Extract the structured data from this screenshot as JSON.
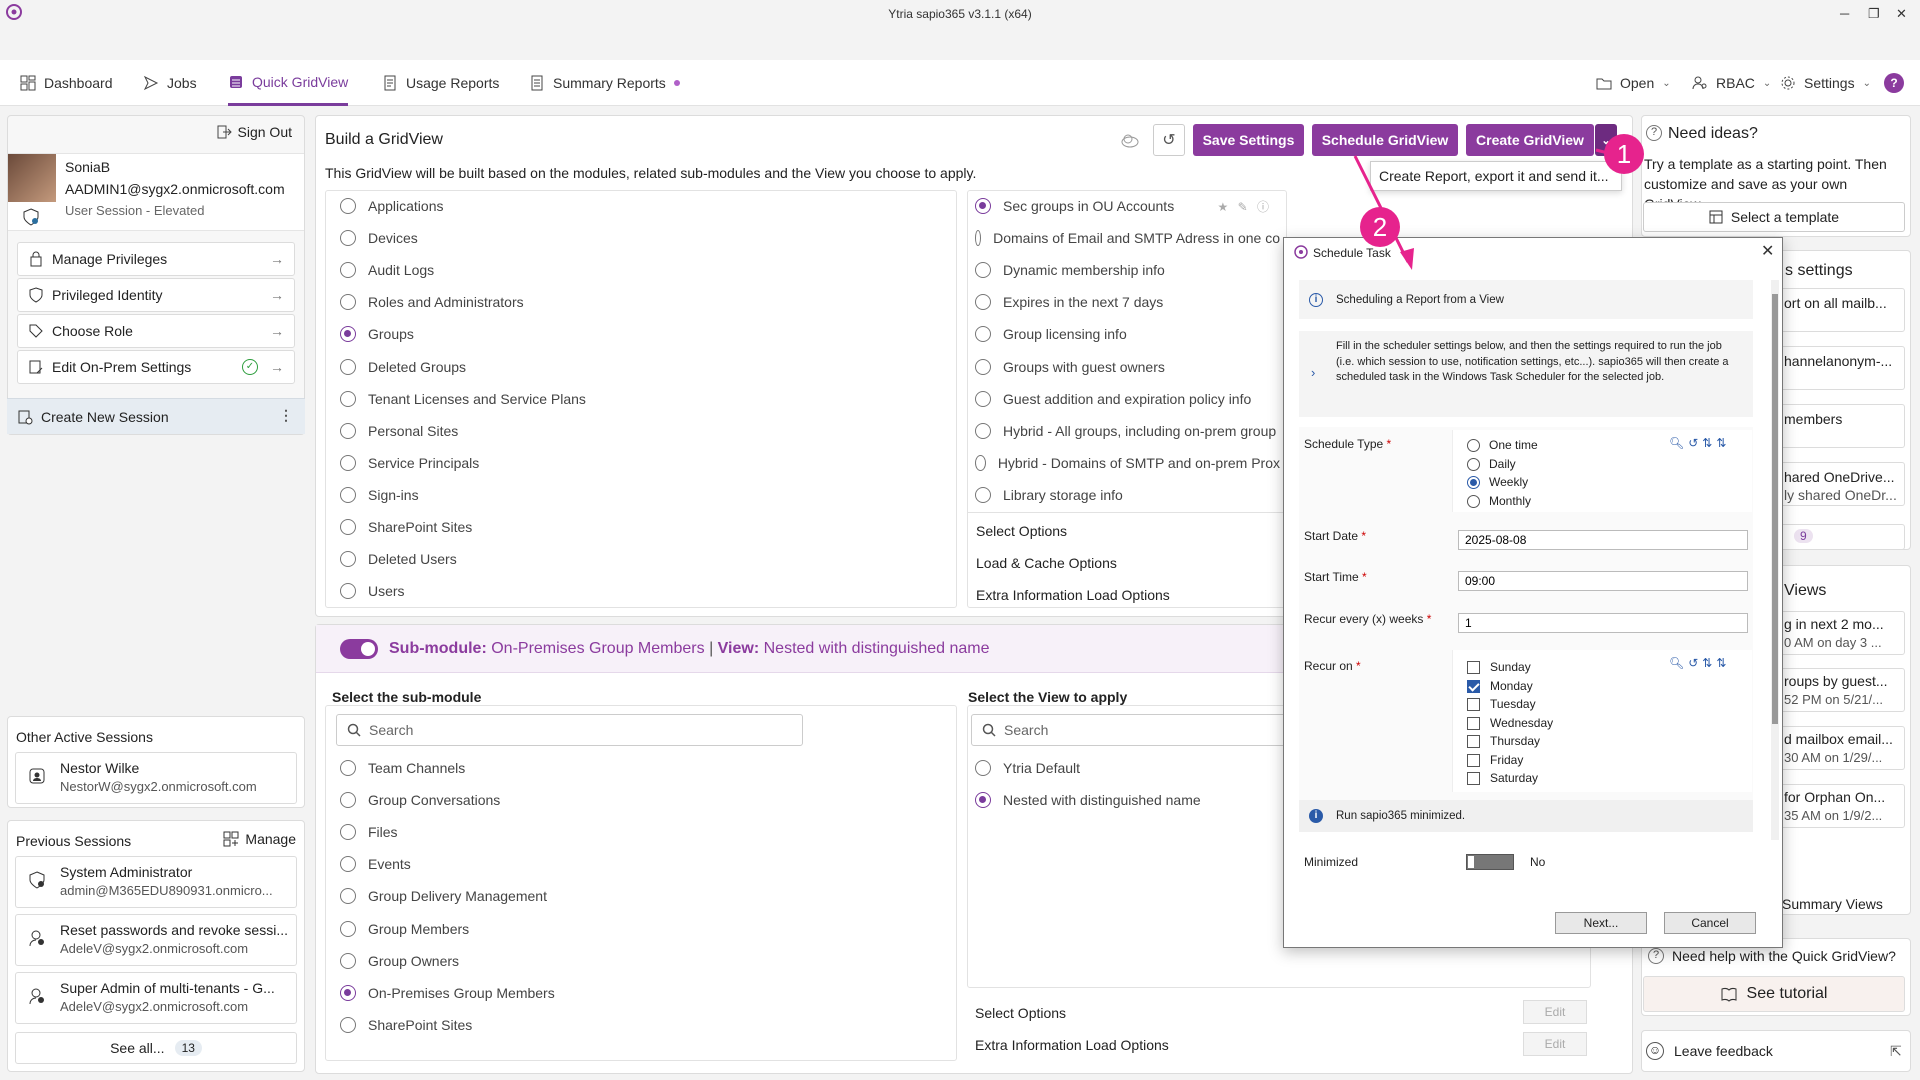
{
  "app_title": "Ytria sapio365 v3.1.1 (x64)",
  "nav": {
    "tabs": [
      "Dashboard",
      "Jobs",
      "Quick GridView",
      "Usage Reports",
      "Summary Reports"
    ],
    "open": "Open",
    "rbac": "RBAC",
    "settings": "Settings"
  },
  "left": {
    "sign_out": "Sign Out",
    "user_name": "SoniaB",
    "user_email": "AADMIN1@sygx2.onmicrosoft.com",
    "user_session": "User Session - Elevated",
    "items": [
      "Manage Privileges",
      "Privileged Identity",
      "Choose Role",
      "Edit On-Prem Settings"
    ],
    "create_session": "Create New Session",
    "other_title": "Other Active Sessions",
    "other": [
      {
        "name": "Nestor Wilke",
        "email": "NestorW@sygx2.onmicrosoft.com"
      }
    ],
    "previous_title": "Previous Sessions",
    "manage": "Manage",
    "previous": [
      {
        "name": "System Administrator",
        "email": "admin@M365EDU890931.onmicro..."
      },
      {
        "name": "Reset passwords and revoke sessi...",
        "email": "AdeleV@sygx2.onmicrosoft.com"
      },
      {
        "name": "Super Admin of multi-tenants - G...",
        "email": "AdeleV@sygx2.onmicrosoft.com"
      }
    ],
    "see_all": "See all...",
    "see_all_count": "13"
  },
  "build": {
    "title": "Build a GridView",
    "desc": "This GridView will be built based on the modules, related sub-modules and the View you choose to apply.",
    "save": "Save Settings",
    "schedule": "Schedule GridView",
    "create": "Create GridView",
    "tooltip": "Create Report, export it and send it...",
    "modules": [
      "Applications",
      "Devices",
      "Audit Logs",
      "Roles and Administrators",
      "Groups",
      "Deleted Groups",
      "Tenant Licenses and Service Plans",
      "Personal Sites",
      "Service Principals",
      "Sign-ins",
      "SharePoint Sites",
      "Deleted Users",
      "Users"
    ],
    "views": [
      "Sec groups in OU Accounts",
      "Domains of Email and SMTP Adress in one co",
      "Dynamic membership info",
      "Expires in the next 7 days",
      "Group licensing info",
      "Groups with guest owners",
      "Guest addition and expiration policy info",
      "Hybrid - All groups, including on-prem group",
      "Hybrid - Domains of SMTP and on-prem Prox",
      "Library storage info"
    ],
    "opts": [
      "Select Options",
      "Load & Cache Options",
      "Extra Information Load Options"
    ]
  },
  "sub": {
    "label": "Sub-module:",
    "name": "On-Premises Group Members",
    "sep": "|",
    "view_label": "View:",
    "view_name": "Nested with distinguished name",
    "select_sub": "Select the sub-module",
    "select_view": "Select the View to apply",
    "search": "Search",
    "submodules": [
      "Team Channels",
      "Group Conversations",
      "Files",
      "Events",
      "Group Delivery Management",
      "Group Members",
      "Group Owners",
      "On-Premises Group Members",
      "SharePoint Sites"
    ],
    "subviews": [
      "Ytria Default",
      "Nested with distinguished name"
    ],
    "opts": [
      "Select Options",
      "Extra Information Load Options"
    ],
    "edit": "Edit"
  },
  "right": {
    "need_ideas": "Need ideas?",
    "ideas_text": "Try a template as a starting point. Then customize and save as your own GridView.",
    "select_template": "Select a template",
    "settings_head": "s settings",
    "cards": [
      {
        "l1": "ort on all mailb..."
      },
      {
        "l1": "hannelanonym-..."
      },
      {
        "l1": "members"
      },
      {
        "l1": "hared OneDrive...",
        "l2": "ly shared OneDr..."
      }
    ],
    "badge": "9",
    "views_head": "Views",
    "vcards": [
      {
        "l1": "g in next 2 mo...",
        "l2": "0 AM on day 3 ..."
      },
      {
        "l1": "roups by guest...",
        "l2": "52 PM on 5/21/..."
      },
      {
        "l1": "d mailbox email...",
        "l2": "30 AM on 1/29/..."
      },
      {
        "l1": "for Orphan On...",
        "l2": "35 AM on 1/9/2..."
      }
    ],
    "summary_views": "Summary Views",
    "need_help": "Need help with the Quick GridView?",
    "tutorial": "See tutorial",
    "feedback": "Leave feedback"
  },
  "dialog": {
    "title": "Schedule Task",
    "info1": "Scheduling a Report from a View",
    "info2": "Fill in the scheduler settings below, and then the settings required to run the job (i.e. which session to use, notification settings, etc...). sapio365 will then create a scheduled task in the Windows Task Scheduler for the selected job.",
    "schedule_type": "Schedule Type",
    "types": [
      "One time",
      "Daily",
      "Weekly",
      "Monthly"
    ],
    "start_date_label": "Start Date",
    "start_date": "2025-08-08",
    "start_time_label": "Start Time",
    "start_time": "09:00",
    "recur_label": "Recur every (x) weeks",
    "recur": "1",
    "recur_on": "Recur on",
    "days": [
      "Sunday",
      "Monday",
      "Tuesday",
      "Wednesday",
      "Thursday",
      "Friday",
      "Saturday"
    ],
    "info3": "Run sapio365 minimized.",
    "minimized_label": "Minimized",
    "minimized_val": "No",
    "next": "Next...",
    "cancel": "Cancel"
  },
  "callouts": [
    "1",
    "2"
  ],
  "colors": {
    "accent": "#8b3b9e",
    "callout": "#e6238d"
  }
}
